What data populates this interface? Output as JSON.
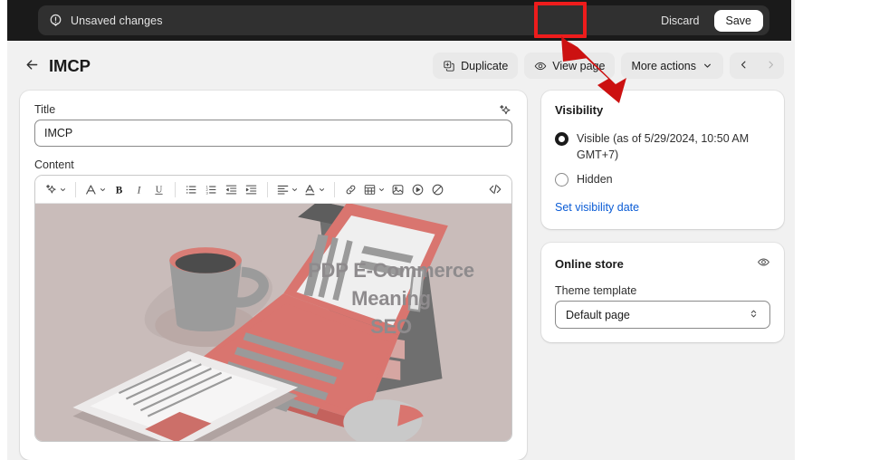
{
  "context_bar": {
    "icon": "alert-circle-icon",
    "message": "Unsaved changes",
    "discard_label": "Discard",
    "save_label": "Save"
  },
  "header": {
    "back_icon": "arrow-left-icon",
    "title": "IMCP",
    "actions": [
      {
        "label": "Duplicate",
        "icon": "duplicate-icon"
      },
      {
        "label": "View page",
        "icon": "eye-icon"
      },
      {
        "label": "More actions",
        "icon": "chevron-down-icon"
      }
    ],
    "pager": {
      "prev_icon": "chevron-left-icon",
      "next_icon": "chevron-right-icon"
    }
  },
  "main": {
    "title_field": {
      "label": "Title",
      "value": "IMCP",
      "placeholder": "",
      "magic_icon": "magic-sparkle-icon"
    },
    "content_field": {
      "label": "Content"
    },
    "toolbar": [
      {
        "name": "ai-magic-tool",
        "icon": "magic-sparkle-icon",
        "caret": true
      },
      {
        "name": "separator",
        "icon": "separator"
      },
      {
        "name": "paragraph-style-tool",
        "icon": "text-style-icon",
        "caret": true
      },
      {
        "name": "bold-tool",
        "icon": "bold-icon",
        "label": "B"
      },
      {
        "name": "italic-tool",
        "icon": "italic-icon",
        "label": "I"
      },
      {
        "name": "underline-tool",
        "icon": "underline-icon",
        "label": "U"
      },
      {
        "name": "separator",
        "icon": "separator"
      },
      {
        "name": "bulleted-list-tool",
        "icon": "bulleted-list-icon"
      },
      {
        "name": "numbered-list-tool",
        "icon": "numbered-list-icon"
      },
      {
        "name": "outdent-tool",
        "icon": "outdent-icon"
      },
      {
        "name": "indent-tool",
        "icon": "indent-icon"
      },
      {
        "name": "separator",
        "icon": "separator"
      },
      {
        "name": "align-tool",
        "icon": "align-left-icon",
        "caret": true
      },
      {
        "name": "text-color-tool",
        "icon": "text-color-icon",
        "caret": true
      },
      {
        "name": "separator",
        "icon": "separator"
      },
      {
        "name": "insert-link-tool",
        "icon": "link-icon"
      },
      {
        "name": "insert-table-tool",
        "icon": "table-icon",
        "caret": true
      },
      {
        "name": "insert-image-tool",
        "icon": "image-icon"
      },
      {
        "name": "insert-video-tool",
        "icon": "video-icon"
      },
      {
        "name": "clear-formatting-tool",
        "icon": "no-symbol-icon"
      },
      {
        "name": "code-view-tool",
        "icon": "code-brackets-icon"
      }
    ],
    "hero": {
      "alt": "isometric illustration of laptop, coffee cup, tablet and mouse",
      "background_color": "#c9bcba",
      "accent_color": "#d9756f",
      "text_color": "#8e8b8d",
      "lines": [
        "PDP E-Commerce",
        "Meaning",
        "SEO"
      ]
    }
  },
  "sidebar": {
    "visibility": {
      "title": "Visibility",
      "options": [
        {
          "label": "Visible (as of 5/29/2024, 10:50 AM GMT+7)",
          "selected": true
        },
        {
          "label": "Hidden",
          "selected": false
        }
      ],
      "link": "Set visibility date",
      "link_color": "#0b5cd5"
    },
    "online_store": {
      "title": "Online store",
      "icon": "eye-icon",
      "template_label": "Theme template",
      "template_value": "Default page"
    }
  },
  "annotations": {
    "highlight_color": "#ee1c1c",
    "highlight_target": "save-button",
    "arrow_target": "save-button"
  }
}
